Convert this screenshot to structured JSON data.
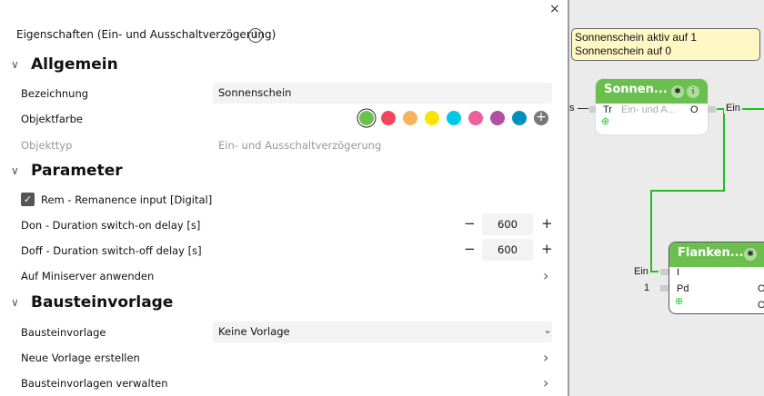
{
  "panel": {
    "title": "Eigenschaften (Ein- und Ausschaltverzögerung)",
    "close": "×",
    "info": "i",
    "sections": {
      "general": "Allgemein",
      "params": "Parameter",
      "template": "Bausteinvorlage"
    },
    "bezeichnung_label": "Bezeichnung",
    "bezeichnung_value": "Sonnenschein",
    "objektfarbe_label": "Objektfarbe",
    "colors": [
      "#6cc24a",
      "#f0475c",
      "#f9b35e",
      "#ffe300",
      "#00c8e8",
      "#ef5f9c",
      "#b150a0",
      "#008fbf"
    ],
    "add_color": "+",
    "objekttyp_label": "Objekttyp",
    "objekttyp_value": "Ein- und Ausschaltverzögerung",
    "rem_label": "Rem - Remanence input [Digital]",
    "rem_checked": true,
    "don_label": "Don - Duration switch-on delay [s]",
    "don_value": "600",
    "doff_label": "Doff - Duration switch-off delay [s]",
    "doff_value": "600",
    "minus": "−",
    "plus": "+",
    "apply_label": "Auf Miniserver anwenden",
    "template_label": "Bausteinvorlage",
    "template_value": "Keine Vorlage",
    "new_template": "Neue Vorlage erstellen",
    "manage_templates": "Bausteinvorlagen verwalten",
    "chevron_right": "›",
    "chevron_down": "⌄",
    "section_chevron": "∨"
  },
  "canvas": {
    "note_lines": [
      "Sonnenschein aktiv auf 1",
      "Sonnenschein auf 0"
    ],
    "block1": {
      "title": "Sonnen...",
      "input": "Tr",
      "desc": "Ein- und A...",
      "output": "O",
      "left_label": "s",
      "right_label": "Ein"
    },
    "block2": {
      "title": "Flanken...",
      "inputs": [
        "I",
        "Pd"
      ],
      "outputs": [
        "O",
        "O"
      ],
      "in_label": "Ein",
      "pd_value": "1"
    },
    "gear": "✱",
    "info": "i",
    "add": "⊕"
  }
}
